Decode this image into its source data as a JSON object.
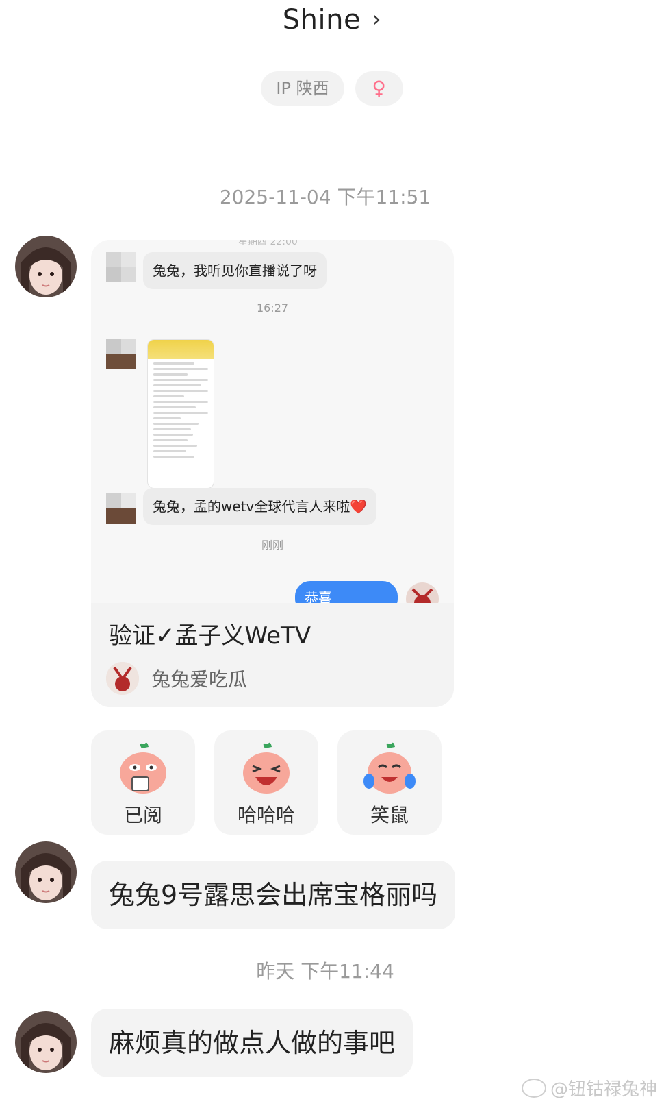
{
  "header": {
    "title": "Shine",
    "chevron_icon": "chevron-right-icon"
  },
  "tags": {
    "ip": "IP 陕西",
    "gender_symbol": "♀",
    "gender_color": "#ff6e8a"
  },
  "timestamps": {
    "first": "2025-11-04 下午11:51",
    "second": "昨天 下午11:44"
  },
  "shared_card": {
    "cut_text": "星期四 22:00",
    "messages": [
      {
        "text": "兔兔，我听见你直播说了呀"
      },
      {
        "time": "16:27"
      },
      {
        "text": "兔兔，孟的wetv全球代言人来啦❤️"
      },
      {
        "time": "刚刚"
      }
    ],
    "sent_preview": "恭喜",
    "title": "验证✓孟子义WeTV",
    "author": "兔兔爱吃瓜"
  },
  "reactions": [
    {
      "label": "已阅",
      "icon": "read-emoji-icon"
    },
    {
      "label": "哈哈哈",
      "icon": "laugh-emoji-icon"
    },
    {
      "label": "笑鼠",
      "icon": "tears-laugh-emoji-icon"
    }
  ],
  "messages": [
    {
      "text": "兔兔9号露思会出席宝格丽吗"
    },
    {
      "text": "麻烦真的做点人做的事吧"
    }
  ],
  "watermark": "@钮钴禄兔神",
  "colors": {
    "bubble_bg": "#f3f3f3",
    "sent_blue": "#3d8af7",
    "timestamp": "#9a9a9a"
  }
}
